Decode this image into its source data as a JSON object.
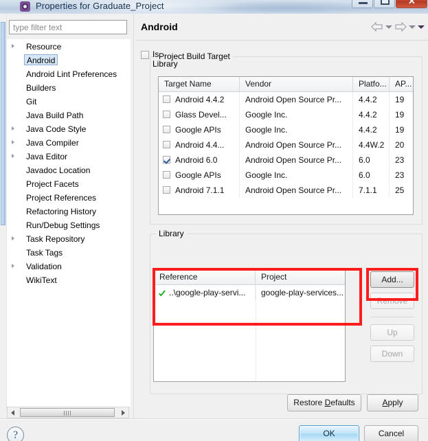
{
  "window": {
    "title": "Properties for Graduate_Project",
    "icon": "eclipse-gear-icon",
    "minimize_label": "",
    "maximize_label": "",
    "close_label": "✕"
  },
  "filter": {
    "placeholder": "type filter text",
    "value": ""
  },
  "tree": {
    "items": [
      {
        "label": "Resource",
        "expandable": true,
        "selected": false
      },
      {
        "label": "Android",
        "expandable": false,
        "selected": true
      },
      {
        "label": "Android Lint Preferences",
        "expandable": false,
        "selected": false
      },
      {
        "label": "Builders",
        "expandable": false,
        "selected": false
      },
      {
        "label": "Git",
        "expandable": false,
        "selected": false
      },
      {
        "label": "Java Build Path",
        "expandable": false,
        "selected": false
      },
      {
        "label": "Java Code Style",
        "expandable": true,
        "selected": false
      },
      {
        "label": "Java Compiler",
        "expandable": true,
        "selected": false
      },
      {
        "label": "Java Editor",
        "expandable": true,
        "selected": false
      },
      {
        "label": "Javadoc Location",
        "expandable": false,
        "selected": false
      },
      {
        "label": "Project Facets",
        "expandable": false,
        "selected": false
      },
      {
        "label": "Project References",
        "expandable": false,
        "selected": false
      },
      {
        "label": "Refactoring History",
        "expandable": false,
        "selected": false
      },
      {
        "label": "Run/Debug Settings",
        "expandable": false,
        "selected": false
      },
      {
        "label": "Task Repository",
        "expandable": true,
        "selected": false
      },
      {
        "label": "Task Tags",
        "expandable": false,
        "selected": false
      },
      {
        "label": "Validation",
        "expandable": true,
        "selected": false
      },
      {
        "label": "WikiText",
        "expandable": false,
        "selected": false
      }
    ]
  },
  "pane": {
    "title": "Android",
    "nav": {
      "back_icon": "back-arrow-icon",
      "back_menu_icon": "chevron-down-icon",
      "forward_icon": "forward-arrow-icon",
      "forward_menu_icon": "chevron-down-icon",
      "view_menu_icon": "chevron-down-icon"
    }
  },
  "build_target": {
    "group_label": "Project Build Target",
    "columns": [
      "Target Name",
      "Vendor",
      "Platfo...",
      "AP..."
    ],
    "rows": [
      {
        "checked": false,
        "name": "Android 4.4.2",
        "vendor": "Android Open Source Pr...",
        "platform": "4.4.2",
        "api": "19"
      },
      {
        "checked": false,
        "name": "Glass Devel...",
        "vendor": "Google Inc.",
        "platform": "4.4.2",
        "api": "19"
      },
      {
        "checked": false,
        "name": "Google APIs",
        "vendor": "Google Inc.",
        "platform": "4.4.2",
        "api": "19"
      },
      {
        "checked": false,
        "name": "Android 4.4...",
        "vendor": "Android Open Source Pr...",
        "platform": "4.4W.2",
        "api": "20"
      },
      {
        "checked": true,
        "name": "Android 6.0",
        "vendor": "Android Open Source Pr...",
        "platform": "6.0",
        "api": "23"
      },
      {
        "checked": false,
        "name": "Google APIs",
        "vendor": "Google Inc.",
        "platform": "6.0",
        "api": "23"
      },
      {
        "checked": false,
        "name": "Android 7.1.1",
        "vendor": "Android Open Source Pr...",
        "platform": "7.1.1",
        "api": "25"
      }
    ]
  },
  "library": {
    "group_label": "Library",
    "is_library_label": "Is Library",
    "is_library_checked": false,
    "columns": [
      "Reference",
      "Project"
    ],
    "rows": [
      {
        "status_icon": "green-check-icon",
        "reference": "..\\google-play-servi...",
        "project": "google-play-services..."
      }
    ],
    "buttons": [
      {
        "label": "Add...",
        "enabled": true
      },
      {
        "label": "Remove",
        "enabled": false
      },
      {
        "label": "Up",
        "enabled": false
      },
      {
        "label": "Down",
        "enabled": false
      }
    ]
  },
  "annotations": {
    "color": "#fb1c1c",
    "boxes": [
      "library-reference-table",
      "add-button"
    ]
  },
  "footer": {
    "restore_defaults": {
      "pre": "Restore ",
      "mnemonic": "D",
      "post": "efaults"
    },
    "apply": {
      "pre": "",
      "mnemonic": "A",
      "post": "pply"
    },
    "ok": "OK",
    "cancel": "Cancel",
    "help_icon": "question-mark-icon"
  }
}
